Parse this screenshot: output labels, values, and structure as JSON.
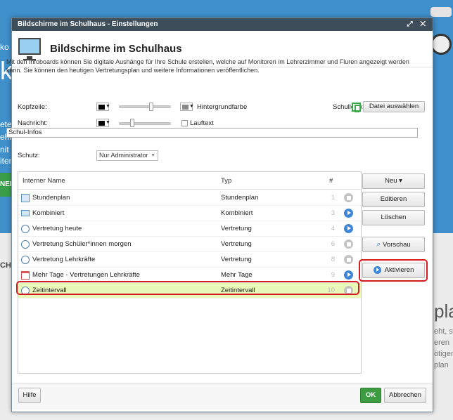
{
  "background": {
    "left_fragments": [
      "ko",
      "k",
      "ete",
      "ehr",
      "nit",
      "iten"
    ],
    "green_button": "NEI",
    "section_left": "CH",
    "right_fragments": [
      "pla",
      "eht, s",
      "eren",
      "ötigen",
      "plan"
    ]
  },
  "dialog": {
    "title": "Bildschirme im Schulhaus - Einstellungen",
    "titlebar_icons": "⤢ ✕",
    "header_title": "Bildschirme im Schulhaus",
    "intro": "Mit den Infoboards können Sie digitale Aushänge für Ihre Schule erstellen, welche auf Monitoren im Lehrerzimmer und Fluren angezeigt werden kann. Sie können den heutigen Vertretungsplan und weitere Informationen veröffentlichen."
  },
  "form": {
    "kopfzeile_label": "Kopfzeile:",
    "hintergrundfarbe_label": "Hintergrundfarbe",
    "schullogo_label": "Schullogo:",
    "datei_button": "Datei auswählen",
    "nachricht_label": "Nachricht:",
    "lauftext_label": "Lauftext",
    "message_value": "Schul-Infos",
    "schutz_label": "Schutz:",
    "schutz_value": "Nur Administrator",
    "kopfzeile_slider": 0.62,
    "nachricht_slider": 0.25
  },
  "table": {
    "headers": {
      "name": "Interner Name",
      "type": "Typ",
      "num": "#"
    },
    "rows": [
      {
        "name": "Stundenplan",
        "type": "Stundenplan",
        "num": "1",
        "status": "stop",
        "icon": "grid-icon"
      },
      {
        "name": "Kombiniert",
        "type": "Kombiniert",
        "num": "3",
        "status": "play",
        "icon": "monitor-icon"
      },
      {
        "name": "Vertretung heute",
        "type": "Vertretung",
        "num": "4",
        "status": "play",
        "icon": "person-icon"
      },
      {
        "name": "Vertretung Schüler*innen morgen",
        "type": "Vertretung",
        "num": "6",
        "status": "stop",
        "icon": "person-icon"
      },
      {
        "name": "Vertretung Lehrkräfte",
        "type": "Vertretung",
        "num": "8",
        "status": "stop",
        "icon": "person-icon"
      },
      {
        "name": "Mehr Tage - Vertretungen Lehrkräfte",
        "type": "Mehr Tage",
        "num": "9",
        "status": "play",
        "icon": "calendar-icon"
      },
      {
        "name": "Zeitintervall",
        "type": "Zeitintervall",
        "num": "10",
        "status": "stop",
        "icon": "clock-icon"
      }
    ]
  },
  "side_buttons": {
    "neu": "Neu ▾",
    "editieren": "Editieren",
    "loeschen": "Löschen",
    "vorschau": "Vorschau",
    "aktivieren": "Aktivieren"
  },
  "footer": {
    "hilfe": "Hilfe",
    "ok": "OK",
    "abbrechen": "Abbrechen"
  },
  "colors": {
    "accent_blue": "#3d86d8",
    "ok_green": "#3d9c42",
    "highlight_red": "#d61c23",
    "selected_row": "#e8f8b8"
  }
}
